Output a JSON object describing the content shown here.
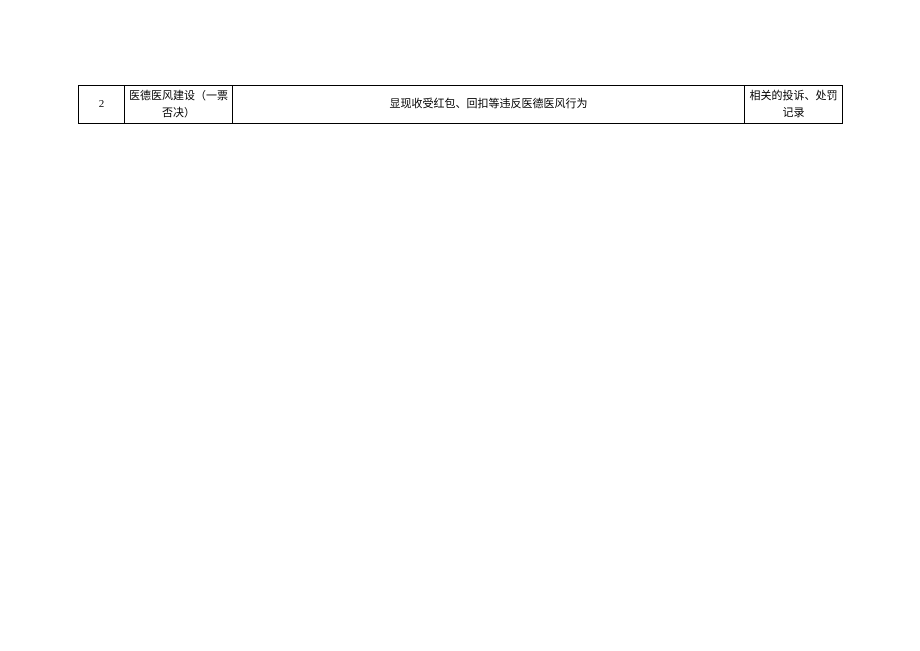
{
  "table": {
    "rows": [
      {
        "index": "2",
        "category": "医德医风建设（一票否决）",
        "description": "显现收受红包、回扣等违反医德医风行为",
        "notes": "相关的投诉、处罚记录"
      }
    ]
  }
}
